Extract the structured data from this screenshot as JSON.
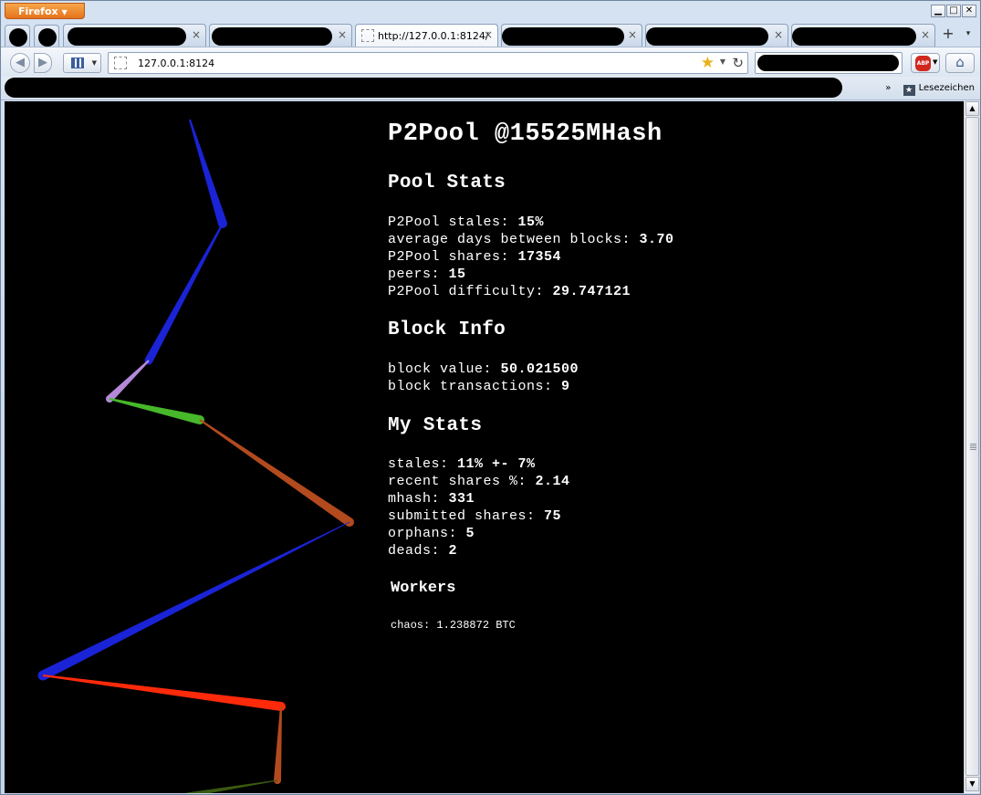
{
  "browser": {
    "app_button": "Firefox",
    "controls": {
      "minimize": "▁",
      "maximize": "□",
      "close": "✕"
    }
  },
  "tabs": [
    {
      "label": "",
      "close": "×"
    },
    {
      "label": "",
      "close": "×"
    },
    {
      "label": "http://127.0.0.1:8124/",
      "close": "×"
    },
    {
      "label": "",
      "close": "×"
    },
    {
      "label": "",
      "close": "×"
    },
    {
      "label": "",
      "close": "×"
    }
  ],
  "navbar": {
    "url": "127.0.0.1:8124",
    "back": "◀",
    "forward": "▶",
    "reload": "↻",
    "star": "★",
    "abp": "ABP"
  },
  "bookmarks": {
    "chevron": "»",
    "label": "Lesezeichen"
  },
  "page": {
    "title": "P2Pool @15525MHash",
    "pool_stats": {
      "heading": "Pool Stats",
      "rows": [
        {
          "label": "P2Pool stales: ",
          "value": "15%"
        },
        {
          "label": "average days between blocks: ",
          "value": "3.70"
        },
        {
          "label": "P2Pool shares: ",
          "value": "17354"
        },
        {
          "label": "peers: ",
          "value": "15"
        },
        {
          "label": "P2Pool difficulty: ",
          "value": "29.747121"
        }
      ]
    },
    "block_info": {
      "heading": "Block Info",
      "rows": [
        {
          "label": "block value: ",
          "value": "50.021500"
        },
        {
          "label": "block transactions: ",
          "value": "9"
        }
      ]
    },
    "my_stats": {
      "heading": "My Stats",
      "rows": [
        {
          "label": "stales: ",
          "value": "11% +- 7%"
        },
        {
          "label": "recent shares %: ",
          "value": "2.14"
        },
        {
          "label": "mhash: ",
          "value": "331"
        },
        {
          "label": "submitted shares: ",
          "value": "75"
        },
        {
          "label": "orphans: ",
          "value": "5"
        },
        {
          "label": "deads: ",
          "value": "2"
        }
      ]
    },
    "workers": {
      "heading": "Workers",
      "items": [
        {
          "name": "chaos:",
          "value": "1.238872 BTC"
        }
      ]
    }
  },
  "graph_colors": [
    "#1a23d6",
    "#1a23d6",
    "#b48ad8",
    "#47b82a",
    "#b24a1e",
    "#1a23d6",
    "#ff2a0a",
    "#b24a1e",
    "#3a5a10"
  ]
}
